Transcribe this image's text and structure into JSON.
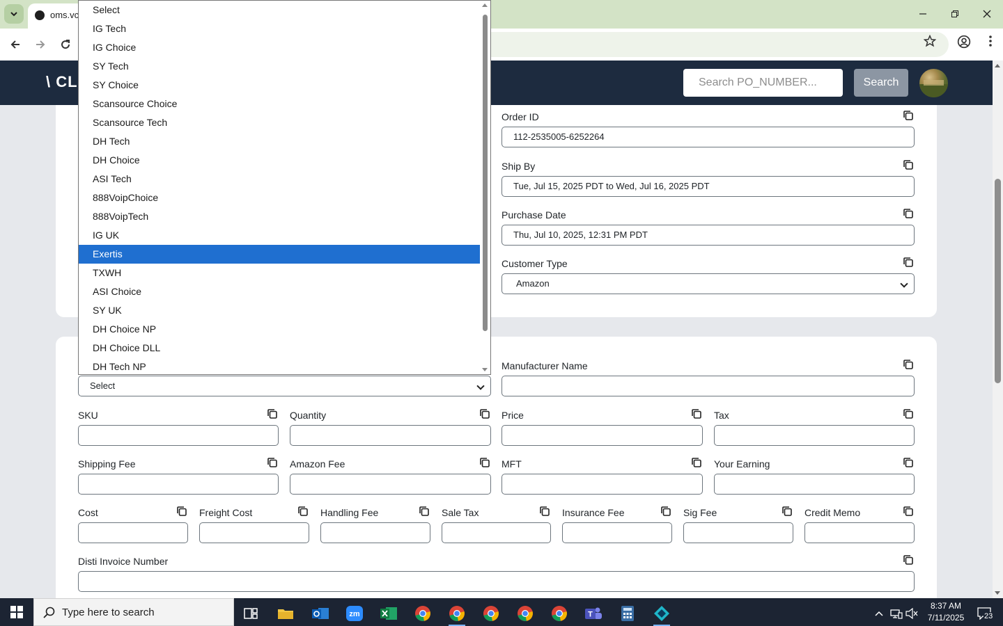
{
  "browser": {
    "tab_title": "oms.vcl",
    "colors": {
      "tabstrip": "#d3e3c6",
      "toolbar": "#ffffff"
    }
  },
  "header": {
    "logo_text": "\\ CL",
    "search_placeholder": "Search PO_NUMBER...",
    "search_button": "Search",
    "background": "#1d2b3f"
  },
  "order": {
    "order_id_label": "Order ID",
    "order_id_value": "112-2535005-6252264",
    "ship_by_label": "Ship By",
    "ship_by_value": "Tue, Jul 15, 2025 PDT to Wed, Jul 16, 2025 PDT",
    "purchase_date_label": "Purchase Date",
    "purchase_date_value": "Thu, Jul 10, 2025, 12:31 PM PDT",
    "customer_type_label": "Customer Type",
    "customer_type_value": "Amazon"
  },
  "dropdown": {
    "current_value": "Select",
    "items": [
      "Select",
      "IG Tech",
      "IG Choice",
      "SY Tech",
      "SY Choice",
      "Scansource Choice",
      "Scansource Tech",
      "DH Tech",
      "DH Choice",
      "ASI Tech",
      "888VoipChoice",
      "888VoipTech",
      "IG UK",
      "Exertis",
      "TXWH",
      "ASI Choice",
      "SY UK",
      "DH Choice NP",
      "DH Choice DLL",
      "DH Tech NP"
    ],
    "highlighted_index": 13,
    "highlight_color": "#1f6fd0"
  },
  "product": {
    "manufacturer_label": "Manufacturer Name",
    "sku_label": "SKU",
    "quantity_label": "Quantity",
    "price_label": "Price",
    "tax_label": "Tax",
    "shipping_fee_label": "Shipping Fee",
    "amazon_fee_label": "Amazon Fee",
    "mft_label": "MFT",
    "your_earning_label": "Your Earning",
    "cost_label": "Cost",
    "freight_cost_label": "Freight Cost",
    "handling_fee_label": "Handling Fee",
    "sale_tax_label": "Sale Tax",
    "insurance_fee_label": "Insurance Fee",
    "sig_fee_label": "Sig Fee",
    "credit_memo_label": "Credit Memo",
    "disti_invoice_label": "Disti Invoice Number"
  },
  "taskbar": {
    "search_text": "Type here to search",
    "time": "8:37 AM",
    "date": "7/11/2025",
    "notification_count": "23",
    "apps": [
      "task-view",
      "file-explorer",
      "outlook",
      "zoom",
      "excel",
      "chrome",
      "chrome",
      "chrome",
      "chrome",
      "chrome",
      "teams",
      "calculator",
      "vscode-like"
    ]
  }
}
